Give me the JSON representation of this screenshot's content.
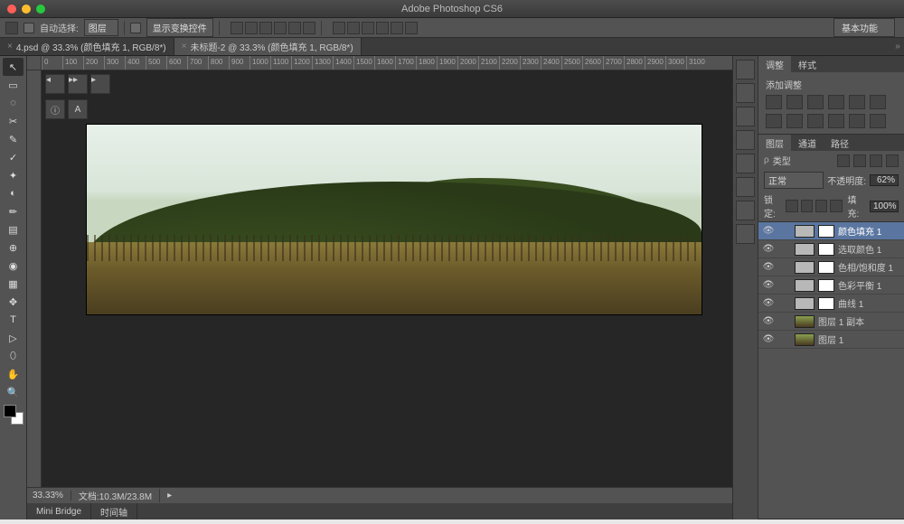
{
  "app_title": "Adobe Photoshop CS6",
  "options_bar": {
    "auto_select": "自动选择:",
    "auto_select_value": "图层",
    "show_transform": "显示变换控件",
    "workspace": "基本功能"
  },
  "doc_tabs": [
    {
      "label": "4.psd @ 33.3% (颜色填充 1, RGB/8*)",
      "active": false
    },
    {
      "label": "未标题-2 @ 33.3% (颜色填充 1, RGB/8*)",
      "active": true
    }
  ],
  "ruler_marks": [
    "0",
    "100",
    "200",
    "300",
    "400",
    "500",
    "600",
    "700",
    "800",
    "900",
    "1000",
    "1100",
    "1200",
    "1300",
    "1400",
    "1500",
    "1600",
    "1700",
    "1800",
    "1900",
    "2000",
    "2100",
    "2200",
    "2300",
    "2400",
    "2500",
    "2600",
    "2700",
    "2800",
    "2900",
    "3000",
    "3100"
  ],
  "status": {
    "zoom": "33.33%",
    "doc_size": "文档:10.3M/23.8M"
  },
  "bottom_tabs": [
    "Mini Bridge",
    "时间轴"
  ],
  "panels": {
    "adjustments": {
      "tabs": [
        "调整",
        "样式"
      ],
      "title": "添加调整"
    },
    "layers": {
      "tabs": [
        "图层",
        "通道",
        "路径"
      ],
      "kind": "类型",
      "blend": "正常",
      "opacity_label": "不透明度:",
      "opacity": "62%",
      "lock": "锁定:",
      "fill_label": "填充:",
      "fill": "100%",
      "items": [
        {
          "name": "颜色填充 1",
          "sel": true,
          "type": "solid"
        },
        {
          "name": "选取颜色 1",
          "type": "solid"
        },
        {
          "name": "色相/饱和度 1",
          "type": "solid"
        },
        {
          "name": "色彩平衡 1",
          "type": "solid"
        },
        {
          "name": "曲线 1",
          "type": "solid"
        },
        {
          "name": "图层 1 副本",
          "type": "img"
        },
        {
          "name": "图层 1",
          "type": "img"
        }
      ]
    }
  },
  "tools": [
    "↖",
    "▭",
    "◌",
    "✂",
    "✎",
    "✓",
    "✦",
    "◐",
    "✏",
    "▤",
    "⊕",
    "◉",
    "▦",
    "✥",
    "T",
    "▷",
    "⬯",
    "✋",
    "🔍"
  ]
}
